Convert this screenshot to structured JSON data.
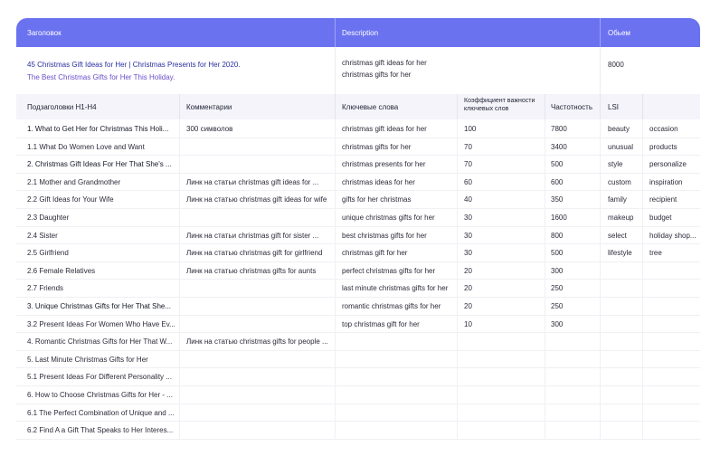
{
  "header": {
    "col_title": "Заголовок",
    "col_description": "Description",
    "col_volume": "Обьем"
  },
  "meta": {
    "title": "45 Christmas Gift Ideas for Her | Christmas Presents for Her 2020.",
    "subtitle": "The Best Christmas Gifts for Her This Holiday.",
    "description_line1": "christmas gift ideas for her",
    "description_line2": "christmas gifts for her",
    "volume": "8000"
  },
  "columns": {
    "subheadings": "Подзаголовки H1-H4",
    "comments": "Комментарии",
    "keywords": "Ключевые слова",
    "kw_coef_line1": "Коэффициент важности",
    "kw_coef_line2": "ключевых слов",
    "frequency": "Частотность",
    "lsi": "LSI"
  },
  "rows": [
    {
      "heading": "1. What to Get Her for Christmas This Holi...",
      "comment": "300 символов",
      "keyword": "christmas gift ideas for her",
      "coef": "100",
      "freq": "7800",
      "lsi1": "beauty",
      "lsi2": "occasion"
    },
    {
      "heading": "1.1 What Do Women Love and Want",
      "comment": "",
      "keyword": "christmas gifts for her",
      "coef": "70",
      "freq": "3400",
      "lsi1": "unusual",
      "lsi2": "products"
    },
    {
      "heading": "2. Christmas Gift Ideas For Her That She's ...",
      "comment": "",
      "keyword": "christmas presents for her",
      "coef": "70",
      "freq": "500",
      "lsi1": "style",
      "lsi2": "personalize"
    },
    {
      "heading": "2.1 Mother and Grandmother",
      "comment": "Линк на статьи christmas gift ideas for ...",
      "keyword": "christmas ideas for her",
      "coef": "60",
      "freq": "600",
      "lsi1": "custom",
      "lsi2": "inspiration"
    },
    {
      "heading": "2.2 Gift Ideas for Your Wife",
      "comment": "Линк на статью christmas gift ideas for wife",
      "keyword": "gifts for her christmas",
      "coef": "40",
      "freq": "350",
      "lsi1": "family",
      "lsi2": "recipient"
    },
    {
      "heading": "2.3 Daughter",
      "comment": "",
      "keyword": "unique christmas gifts for her",
      "coef": "30",
      "freq": "1600",
      "lsi1": "makeup",
      "lsi2": "budget"
    },
    {
      "heading": "2.4 Sister",
      "comment": "Линк на статьи christmas gift for sister ...",
      "keyword": "best christmas gifts for her",
      "coef": "30",
      "freq": "800",
      "lsi1": "select",
      "lsi2": "holiday shop..."
    },
    {
      "heading": "2.5 Girlfriend",
      "comment": "Линк на статью christmas gift for girlfriend",
      "keyword": "christmas gift for her",
      "coef": "30",
      "freq": "500",
      "lsi1": "lifestyle",
      "lsi2": "tree"
    },
    {
      "heading": "2.6 Female Relatives",
      "comment": "Линк на статью christmas gifts for aunts",
      "keyword": "perfect christmas gifts for her",
      "coef": "20",
      "freq": "300",
      "lsi1": "",
      "lsi2": ""
    },
    {
      "heading": "2.7 Friends",
      "comment": "",
      "keyword": "last minute christmas gifts for her",
      "coef": "20",
      "freq": "250",
      "lsi1": "",
      "lsi2": ""
    },
    {
      "heading": "3. Unique Christmas Gifts for Her That She...",
      "comment": "",
      "keyword": "romantic christmas gifts for her",
      "coef": "20",
      "freq": "250",
      "lsi1": "",
      "lsi2": ""
    },
    {
      "heading": "3.2 Present Ideas For Women Who Have Ev...",
      "comment": "",
      "keyword": "top christmas gift for her",
      "coef": "10",
      "freq": "300",
      "lsi1": "",
      "lsi2": ""
    },
    {
      "heading": "4. Romantic Christmas Gifts for Her That W...",
      "comment": "Линк на статью christmas gifts for people ...",
      "keyword": "",
      "coef": "",
      "freq": "",
      "lsi1": "",
      "lsi2": ""
    },
    {
      "heading": "5. Last Minute Christmas Gifts for Her",
      "comment": "",
      "keyword": "",
      "coef": "",
      "freq": "",
      "lsi1": "",
      "lsi2": ""
    },
    {
      "heading": "5.1 Present Ideas For Different Personality ...",
      "comment": "",
      "keyword": "",
      "coef": "",
      "freq": "",
      "lsi1": "",
      "lsi2": ""
    },
    {
      "heading": "6. How to Choose Christmas Gifts for Her - ...",
      "comment": "",
      "keyword": "",
      "coef": "",
      "freq": "",
      "lsi1": "",
      "lsi2": ""
    },
    {
      "heading": "6.1 The Perfect Combination of Unique and ...",
      "comment": "",
      "keyword": "",
      "coef": "",
      "freq": "",
      "lsi1": "",
      "lsi2": ""
    },
    {
      "heading": "6.2 Find A a Gift That Speaks to Her Interes...",
      "comment": "",
      "keyword": "",
      "coef": "",
      "freq": "",
      "lsi1": "",
      "lsi2": ""
    }
  ]
}
